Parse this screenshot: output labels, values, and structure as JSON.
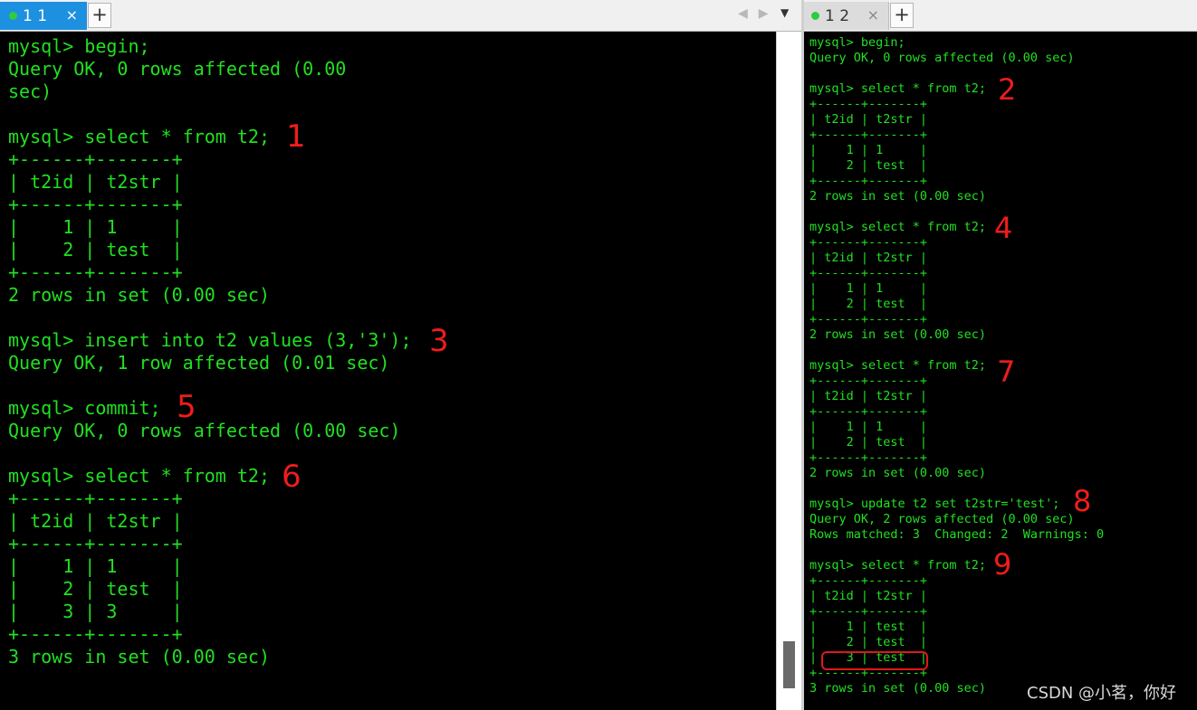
{
  "left": {
    "tab_label": "1 1",
    "close_glyph": "×",
    "add_glyph": "+",
    "nav_glyph": "◀▶",
    "dropdown_glyph": "▼",
    "terminal_text": "mysql> begin;\nQuery OK, 0 rows affected (0.00\nsec)\n\nmysql> select * from t2;\n+------+-------+\n| t2id | t2str |\n+------+-------+\n|    1 | 1     |\n|    2 | test  |\n+------+-------+\n2 rows in set (0.00 sec)\n\nmysql> insert into t2 values (3,'3');\nQuery OK, 1 row affected (0.01 sec)\n\nmysql> commit;\nQuery OK, 0 rows affected (0.00 sec)\n\nmysql> select * from t2;\n+------+-------+\n| t2id | t2str |\n+------+-------+\n|    1 | 1     |\n|    2 | test  |\n|    3 | 3     |\n+------+-------+\n3 rows in set (0.00 sec)",
    "annotations": [
      "1",
      "3",
      "5",
      "6"
    ]
  },
  "right": {
    "tab_label": "1 2",
    "close_glyph": "×",
    "add_glyph": "+",
    "terminal_text": "mysql> begin;\nQuery OK, 0 rows affected (0.00 sec)\n\nmysql> select * from t2;\n+------+-------+\n| t2id | t2str |\n+------+-------+\n|    1 | 1     |\n|    2 | test  |\n+------+-------+\n2 rows in set (0.00 sec)\n\nmysql> select * from t2;\n+------+-------+\n| t2id | t2str |\n+------+-------+\n|    1 | 1     |\n|    2 | test  |\n+------+-------+\n2 rows in set (0.00 sec)\n\nmysql> select * from t2;\n+------+-------+\n| t2id | t2str |\n+------+-------+\n|    1 | 1     |\n|    2 | test  |\n+------+-------+\n2 rows in set (0.00 sec)\n\nmysql> update t2 set t2str='test';\nQuery OK, 2 rows affected (0.00 sec)\nRows matched: 3  Changed: 2  Warnings: 0\n\nmysql> select * from t2;\n+------+-------+\n| t2id | t2str |\n+------+-------+\n|    1 | test  |\n|    2 | test  |\n|    3 | test  |\n+------+-------+\n3 rows in set (0.00 sec)",
    "annotations": [
      "2",
      "4",
      "7",
      "8",
      "9"
    ],
    "watermark": "CSDN @小茗，你好"
  },
  "colors": {
    "terminal_text": "#21e021",
    "terminal_bg": "#000000",
    "annotation": "#f01c1c",
    "active_tab": "#1e90e0"
  }
}
